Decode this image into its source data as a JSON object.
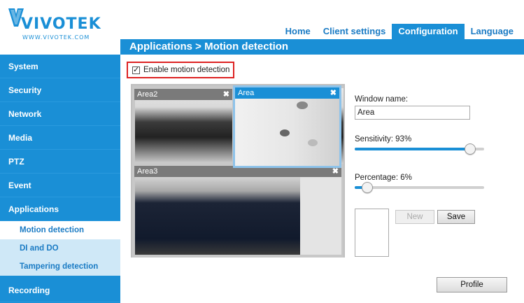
{
  "brand": {
    "name": "VIVOTEK",
    "url_text": "WWW.VIVOTEK.COM"
  },
  "topnav": {
    "items": [
      "Home",
      "Client settings",
      "Configuration",
      "Language"
    ],
    "active": "Configuration"
  },
  "title": "Applications  > Motion detection",
  "sidebar": {
    "items": [
      "System",
      "Security",
      "Network",
      "Media",
      "PTZ",
      "Event",
      "Applications"
    ],
    "subitems": [
      "Motion detection",
      "DI and DO",
      "Tampering detection"
    ],
    "active_sub": "Motion detection",
    "after": [
      "Recording"
    ]
  },
  "enable": {
    "label": "Enable motion detection",
    "checked": true
  },
  "areas": {
    "area2": "Area2",
    "area": "Area",
    "area3": "Area3",
    "close": "✖"
  },
  "panel": {
    "window_name_label": "Window name:",
    "window_name_value": "Area",
    "sensitivity_label": "Sensitivity: 93%",
    "sensitivity": 93,
    "percentage_label": "Percentage: 6%",
    "percentage": 6,
    "new_label": "New",
    "save_label": "Save",
    "profile_label": "Profile"
  },
  "colors": {
    "accent": "#1a8fd6",
    "highlight": "#d22222"
  }
}
